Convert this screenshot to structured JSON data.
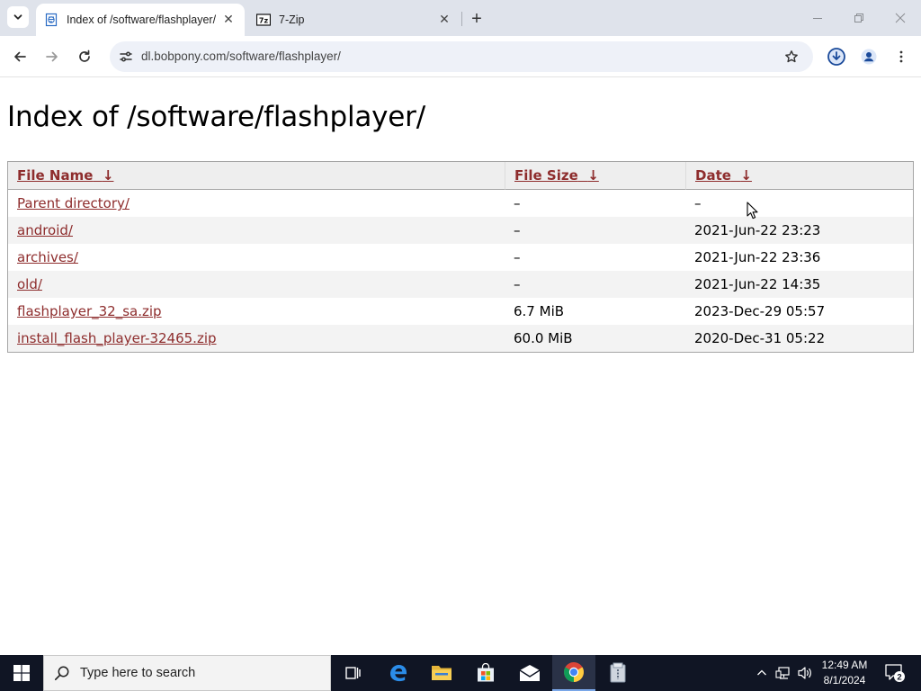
{
  "browser": {
    "tabs": [
      {
        "title": "Index of /software/flashplayer/",
        "active": true,
        "favicon": "page-favicon-icon"
      },
      {
        "title": "7-Zip",
        "active": false,
        "favicon": "7zip-favicon-icon"
      }
    ],
    "new_tab": "+",
    "window_controls": {
      "minimize": "—",
      "restore": "❐",
      "close": "✕"
    },
    "address": "dl.bobpony.com/software/flashplayer/"
  },
  "page": {
    "heading": "Index of /software/flashplayer/",
    "table": {
      "headers": [
        {
          "label": "File Name",
          "sort": "↓"
        },
        {
          "label": "File Size",
          "sort": "↓"
        },
        {
          "label": "Date",
          "sort": "↓"
        }
      ],
      "rows": [
        {
          "name": "Parent directory/",
          "size": "–",
          "date": "–"
        },
        {
          "name": "android/",
          "size": "–",
          "date": "2021-Jun-22 23:23"
        },
        {
          "name": "archives/",
          "size": "–",
          "date": "2021-Jun-22 23:36"
        },
        {
          "name": "old/",
          "size": "–",
          "date": "2021-Jun-22 14:35"
        },
        {
          "name": "flashplayer_32_sa.zip",
          "size": "6.7 MiB",
          "date": "2023-Dec-29 05:57"
        },
        {
          "name": "install_flash_player-32465.zip",
          "size": "60.0 MiB",
          "date": "2020-Dec-31 05:22"
        }
      ]
    }
  },
  "taskbar": {
    "search_placeholder": "Type here to search",
    "apps": [
      "task-view",
      "edge",
      "file-explorer",
      "store",
      "mail",
      "chrome",
      "7zip-archive"
    ],
    "clock": {
      "time": "12:49 AM",
      "date": "8/1/2024"
    },
    "notification_count": "2"
  },
  "colors": {
    "link": "#8e2d2d",
    "tabstrip": "#dfe3eb",
    "omnibox": "#eef1f8",
    "taskbar": "#101524"
  }
}
